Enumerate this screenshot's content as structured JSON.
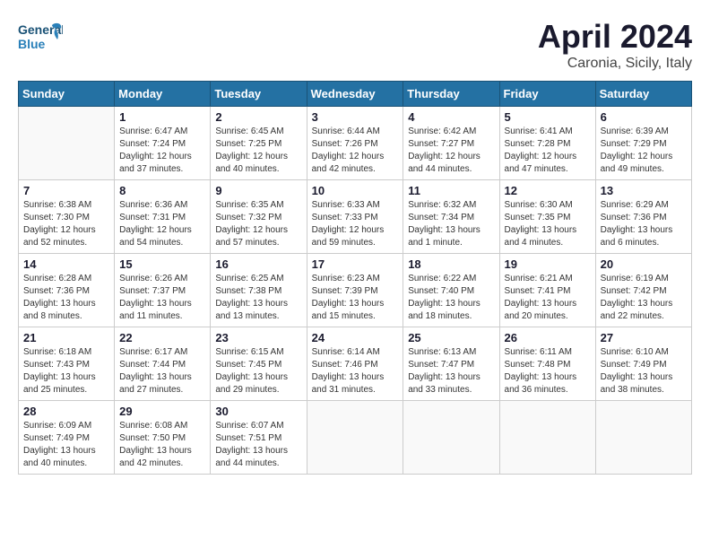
{
  "header": {
    "logo_line1": "General",
    "logo_line2": "Blue",
    "month": "April 2024",
    "location": "Caronia, Sicily, Italy"
  },
  "weekdays": [
    "Sunday",
    "Monday",
    "Tuesday",
    "Wednesday",
    "Thursday",
    "Friday",
    "Saturday"
  ],
  "weeks": [
    [
      {
        "day": "",
        "info": ""
      },
      {
        "day": "1",
        "info": "Sunrise: 6:47 AM\nSunset: 7:24 PM\nDaylight: 12 hours\nand 37 minutes."
      },
      {
        "day": "2",
        "info": "Sunrise: 6:45 AM\nSunset: 7:25 PM\nDaylight: 12 hours\nand 40 minutes."
      },
      {
        "day": "3",
        "info": "Sunrise: 6:44 AM\nSunset: 7:26 PM\nDaylight: 12 hours\nand 42 minutes."
      },
      {
        "day": "4",
        "info": "Sunrise: 6:42 AM\nSunset: 7:27 PM\nDaylight: 12 hours\nand 44 minutes."
      },
      {
        "day": "5",
        "info": "Sunrise: 6:41 AM\nSunset: 7:28 PM\nDaylight: 12 hours\nand 47 minutes."
      },
      {
        "day": "6",
        "info": "Sunrise: 6:39 AM\nSunset: 7:29 PM\nDaylight: 12 hours\nand 49 minutes."
      }
    ],
    [
      {
        "day": "7",
        "info": "Sunrise: 6:38 AM\nSunset: 7:30 PM\nDaylight: 12 hours\nand 52 minutes."
      },
      {
        "day": "8",
        "info": "Sunrise: 6:36 AM\nSunset: 7:31 PM\nDaylight: 12 hours\nand 54 minutes."
      },
      {
        "day": "9",
        "info": "Sunrise: 6:35 AM\nSunset: 7:32 PM\nDaylight: 12 hours\nand 57 minutes."
      },
      {
        "day": "10",
        "info": "Sunrise: 6:33 AM\nSunset: 7:33 PM\nDaylight: 12 hours\nand 59 minutes."
      },
      {
        "day": "11",
        "info": "Sunrise: 6:32 AM\nSunset: 7:34 PM\nDaylight: 13 hours\nand 1 minute."
      },
      {
        "day": "12",
        "info": "Sunrise: 6:30 AM\nSunset: 7:35 PM\nDaylight: 13 hours\nand 4 minutes."
      },
      {
        "day": "13",
        "info": "Sunrise: 6:29 AM\nSunset: 7:36 PM\nDaylight: 13 hours\nand 6 minutes."
      }
    ],
    [
      {
        "day": "14",
        "info": "Sunrise: 6:28 AM\nSunset: 7:36 PM\nDaylight: 13 hours\nand 8 minutes."
      },
      {
        "day": "15",
        "info": "Sunrise: 6:26 AM\nSunset: 7:37 PM\nDaylight: 13 hours\nand 11 minutes."
      },
      {
        "day": "16",
        "info": "Sunrise: 6:25 AM\nSunset: 7:38 PM\nDaylight: 13 hours\nand 13 minutes."
      },
      {
        "day": "17",
        "info": "Sunrise: 6:23 AM\nSunset: 7:39 PM\nDaylight: 13 hours\nand 15 minutes."
      },
      {
        "day": "18",
        "info": "Sunrise: 6:22 AM\nSunset: 7:40 PM\nDaylight: 13 hours\nand 18 minutes."
      },
      {
        "day": "19",
        "info": "Sunrise: 6:21 AM\nSunset: 7:41 PM\nDaylight: 13 hours\nand 20 minutes."
      },
      {
        "day": "20",
        "info": "Sunrise: 6:19 AM\nSunset: 7:42 PM\nDaylight: 13 hours\nand 22 minutes."
      }
    ],
    [
      {
        "day": "21",
        "info": "Sunrise: 6:18 AM\nSunset: 7:43 PM\nDaylight: 13 hours\nand 25 minutes."
      },
      {
        "day": "22",
        "info": "Sunrise: 6:17 AM\nSunset: 7:44 PM\nDaylight: 13 hours\nand 27 minutes."
      },
      {
        "day": "23",
        "info": "Sunrise: 6:15 AM\nSunset: 7:45 PM\nDaylight: 13 hours\nand 29 minutes."
      },
      {
        "day": "24",
        "info": "Sunrise: 6:14 AM\nSunset: 7:46 PM\nDaylight: 13 hours\nand 31 minutes."
      },
      {
        "day": "25",
        "info": "Sunrise: 6:13 AM\nSunset: 7:47 PM\nDaylight: 13 hours\nand 33 minutes."
      },
      {
        "day": "26",
        "info": "Sunrise: 6:11 AM\nSunset: 7:48 PM\nDaylight: 13 hours\nand 36 minutes."
      },
      {
        "day": "27",
        "info": "Sunrise: 6:10 AM\nSunset: 7:49 PM\nDaylight: 13 hours\nand 38 minutes."
      }
    ],
    [
      {
        "day": "28",
        "info": "Sunrise: 6:09 AM\nSunset: 7:49 PM\nDaylight: 13 hours\nand 40 minutes."
      },
      {
        "day": "29",
        "info": "Sunrise: 6:08 AM\nSunset: 7:50 PM\nDaylight: 13 hours\nand 42 minutes."
      },
      {
        "day": "30",
        "info": "Sunrise: 6:07 AM\nSunset: 7:51 PM\nDaylight: 13 hours\nand 44 minutes."
      },
      {
        "day": "",
        "info": ""
      },
      {
        "day": "",
        "info": ""
      },
      {
        "day": "",
        "info": ""
      },
      {
        "day": "",
        "info": ""
      }
    ]
  ]
}
